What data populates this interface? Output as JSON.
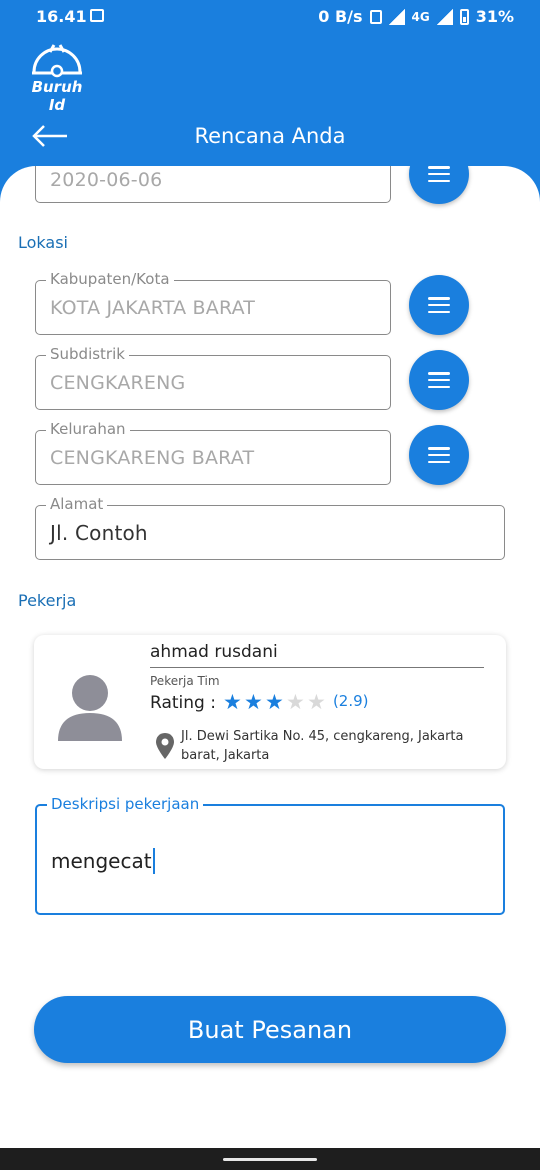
{
  "status_bar": {
    "time": "16.41",
    "network_speed": "0 B/s",
    "network_type": "4G",
    "battery": "31%",
    "icons": [
      "gallery-icon",
      "vibrate-icon",
      "signal-icon",
      "battery-icon"
    ]
  },
  "app": {
    "logo_text": "Buruh Id",
    "title": "Rencana Anda",
    "accent_color": "#1a7fde"
  },
  "schedule": {
    "date_value": "2020-06-06"
  },
  "location": {
    "section_title": "Lokasi",
    "kabupaten": {
      "label": "Kabupaten/Kota",
      "value": "KOTA JAKARTA BARAT"
    },
    "subdistrik": {
      "label": "Subdistrik",
      "value": "CENGKARENG"
    },
    "kelurahan": {
      "label": "Kelurahan",
      "value": "CENGKARENG BARAT"
    },
    "alamat": {
      "label": "Alamat",
      "value": "Jl. Contoh"
    }
  },
  "worker": {
    "section_title": "Pekerja",
    "name": "ahmad rusdani",
    "type": "Pekerja Tim",
    "rating_label": "Rating :",
    "rating_stars_filled": 3,
    "rating_stars_total": 5,
    "rating_value": "(2.9)",
    "address": "Jl. Dewi Sartika No. 45, cengkareng, Jakarta barat, Jakarta"
  },
  "description": {
    "label": "Deskripsi pekerjaan",
    "value": "mengecat"
  },
  "submit_label": "Buat Pesanan"
}
